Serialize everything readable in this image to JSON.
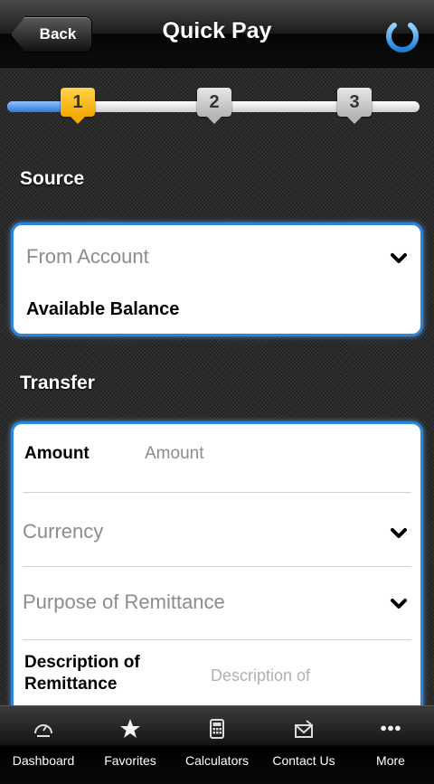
{
  "header": {
    "back_label": "Back",
    "title": "Quick Pay",
    "power_icon": "power-icon"
  },
  "steps": [
    {
      "label": "1",
      "active": true
    },
    {
      "label": "2",
      "active": false
    },
    {
      "label": "3",
      "active": false
    }
  ],
  "source": {
    "heading": "Source",
    "from_account_placeholder": "From Account",
    "available_balance_label": "Available Balance"
  },
  "transfer": {
    "heading": "Transfer",
    "amount_label": "Amount",
    "amount_placeholder": "Amount",
    "currency_placeholder": "Currency",
    "purpose_placeholder": "Purpose of Remittance",
    "description_label_line1": "Description of",
    "description_label_line2": "Remittance",
    "description_placeholder": "Description of"
  },
  "tabbar": {
    "items": [
      {
        "label": "Dashboard",
        "icon": "speedometer-icon"
      },
      {
        "label": "Favorites",
        "icon": "star-icon"
      },
      {
        "label": "Calculators",
        "icon": "calculator-icon"
      },
      {
        "label": "Contact Us",
        "icon": "envelope-icon"
      },
      {
        "label": "More",
        "icon": "more-dots-icon"
      }
    ]
  },
  "colors": {
    "accent_blue": "#2a86d8",
    "step_active": "#f2a900",
    "step_inactive": "#b5b5b5"
  }
}
